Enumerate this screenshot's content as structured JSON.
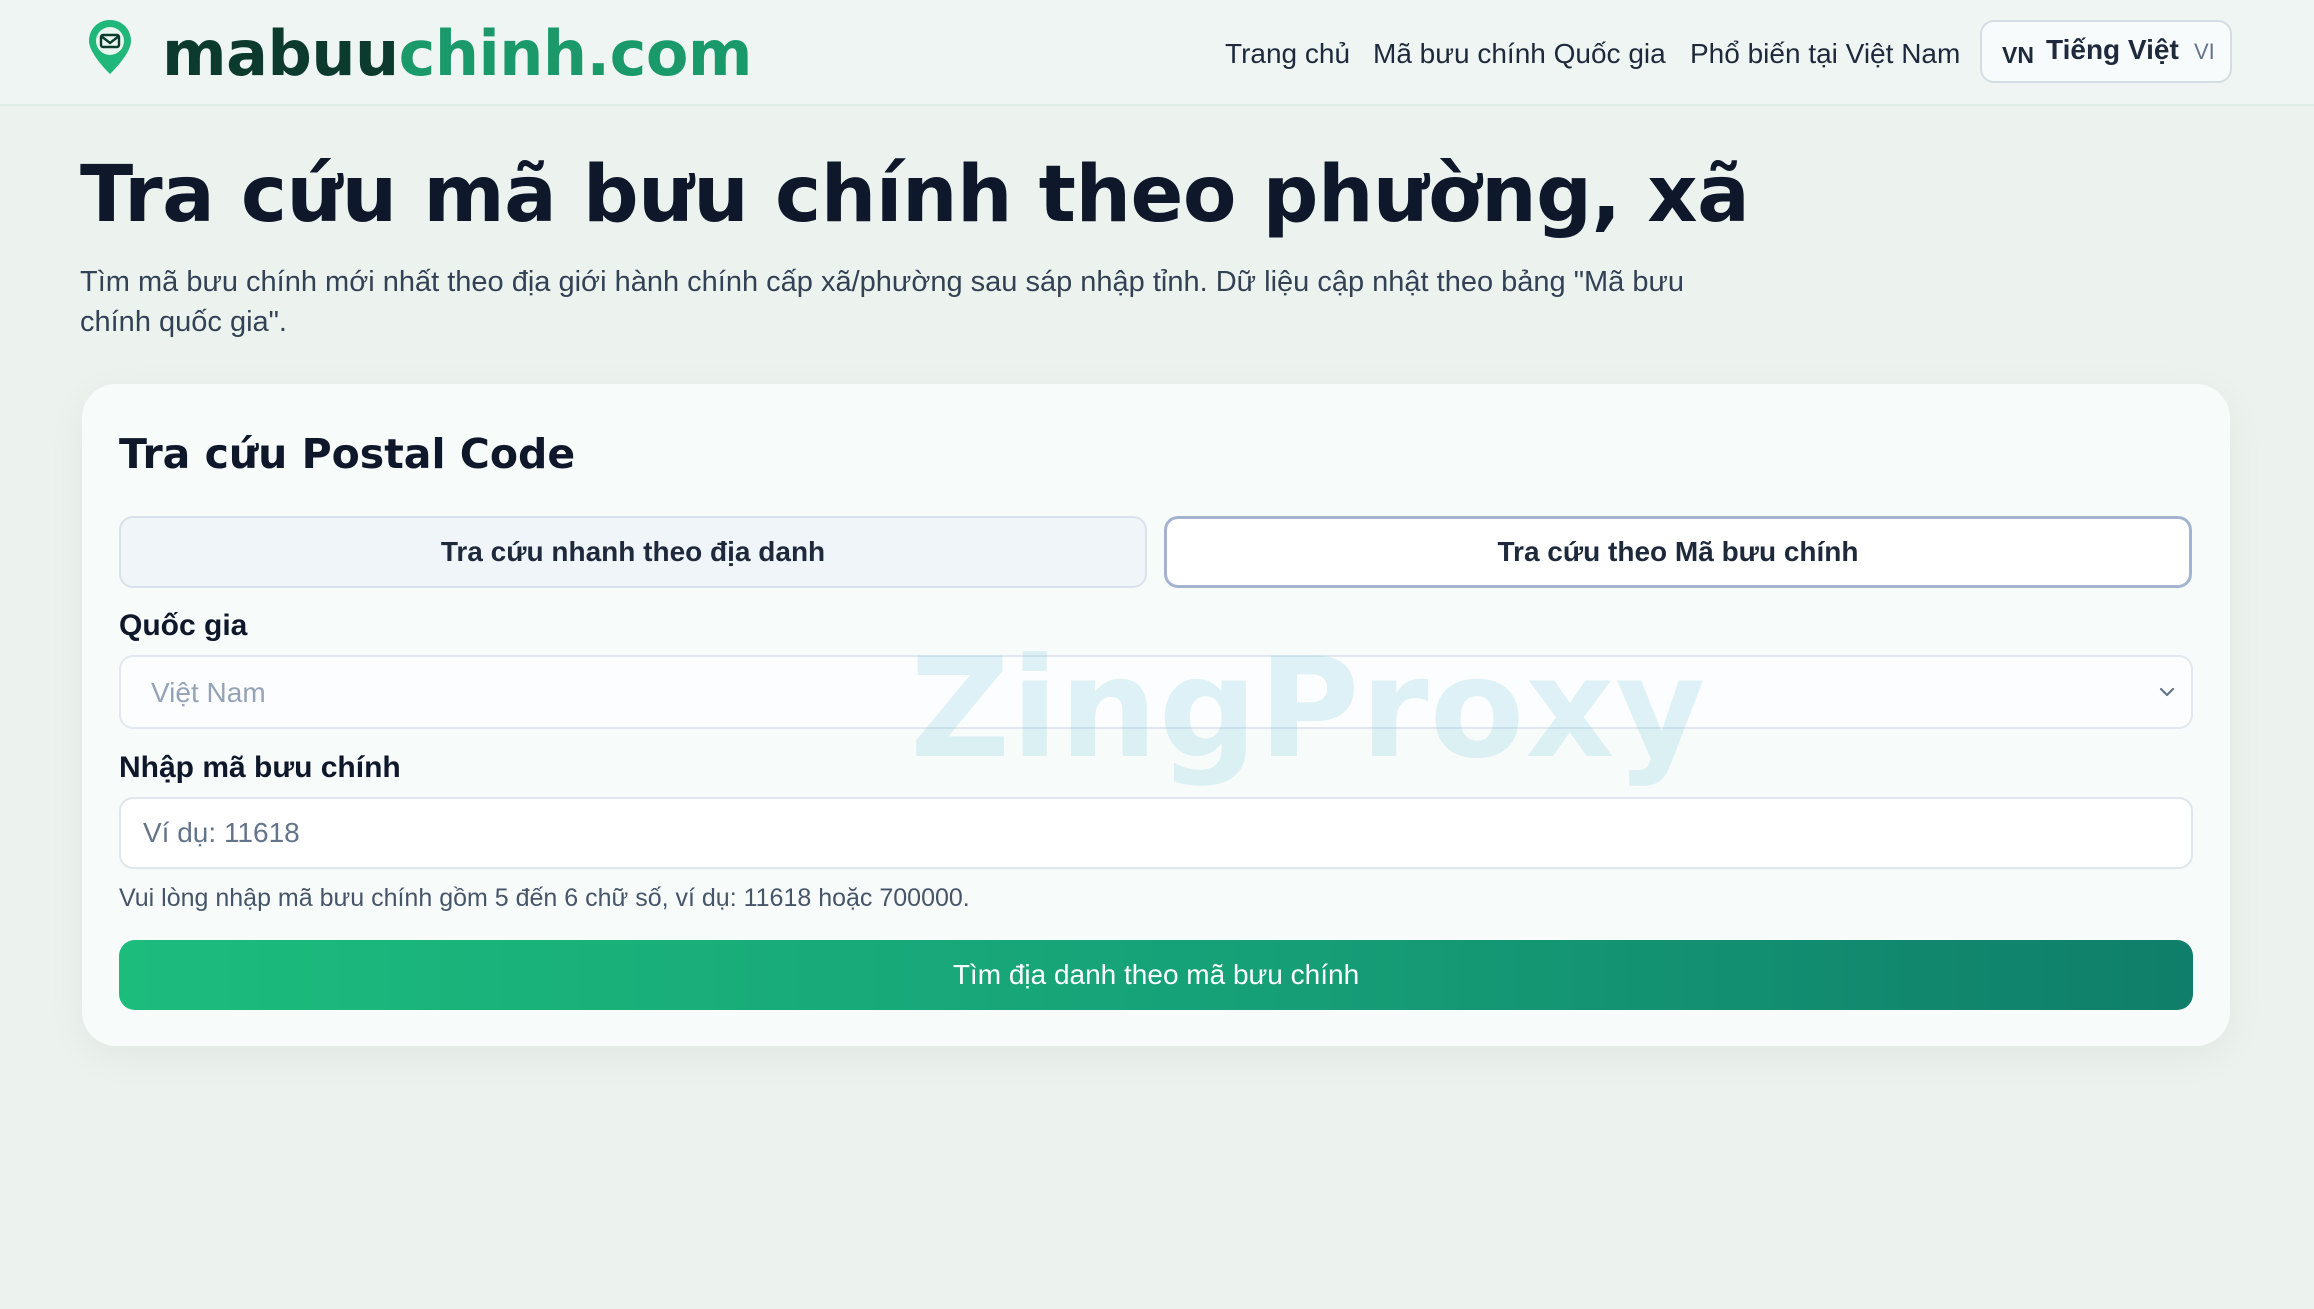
{
  "brand": {
    "name_part1": "mabuu",
    "name_part2": "chinh.com"
  },
  "nav": {
    "items": [
      "Trang chủ",
      "Mã bưu chính Quốc gia",
      "Phổ biến tại Việt Nam"
    ],
    "language": {
      "code": "VN",
      "name": "Tiếng Việt",
      "short": "VI"
    }
  },
  "page": {
    "title": "Tra cứu mã bưu chính theo phường, xã",
    "description": "Tìm mã bưu chính mới nhất theo địa giới hành chính cấp xã/phường sau sáp nhập tỉnh. Dữ liệu cập nhật theo bảng \"Mã bưu chính quốc gia\"."
  },
  "card": {
    "title": "Tra cứu Postal Code",
    "tabs": [
      "Tra cứu nhanh theo địa danh",
      "Tra cứu theo Mã bưu chính"
    ],
    "country_label": "Quốc gia",
    "country_value": "Việt Nam",
    "postal_label": "Nhập mã bưu chính",
    "postal_placeholder": "Ví dụ: 11618",
    "hint": "Vui lòng nhập mã bưu chính gồm 5 đến 6 chữ số, ví dụ: 11618 hoặc 700000.",
    "submit_label": "Tìm địa danh theo mã bưu chính"
  },
  "watermark": "ZingProxy",
  "colors": {
    "accent": "#16a077",
    "brand_dark": "#0c3b2e",
    "brand_green": "#1a9a6b"
  }
}
